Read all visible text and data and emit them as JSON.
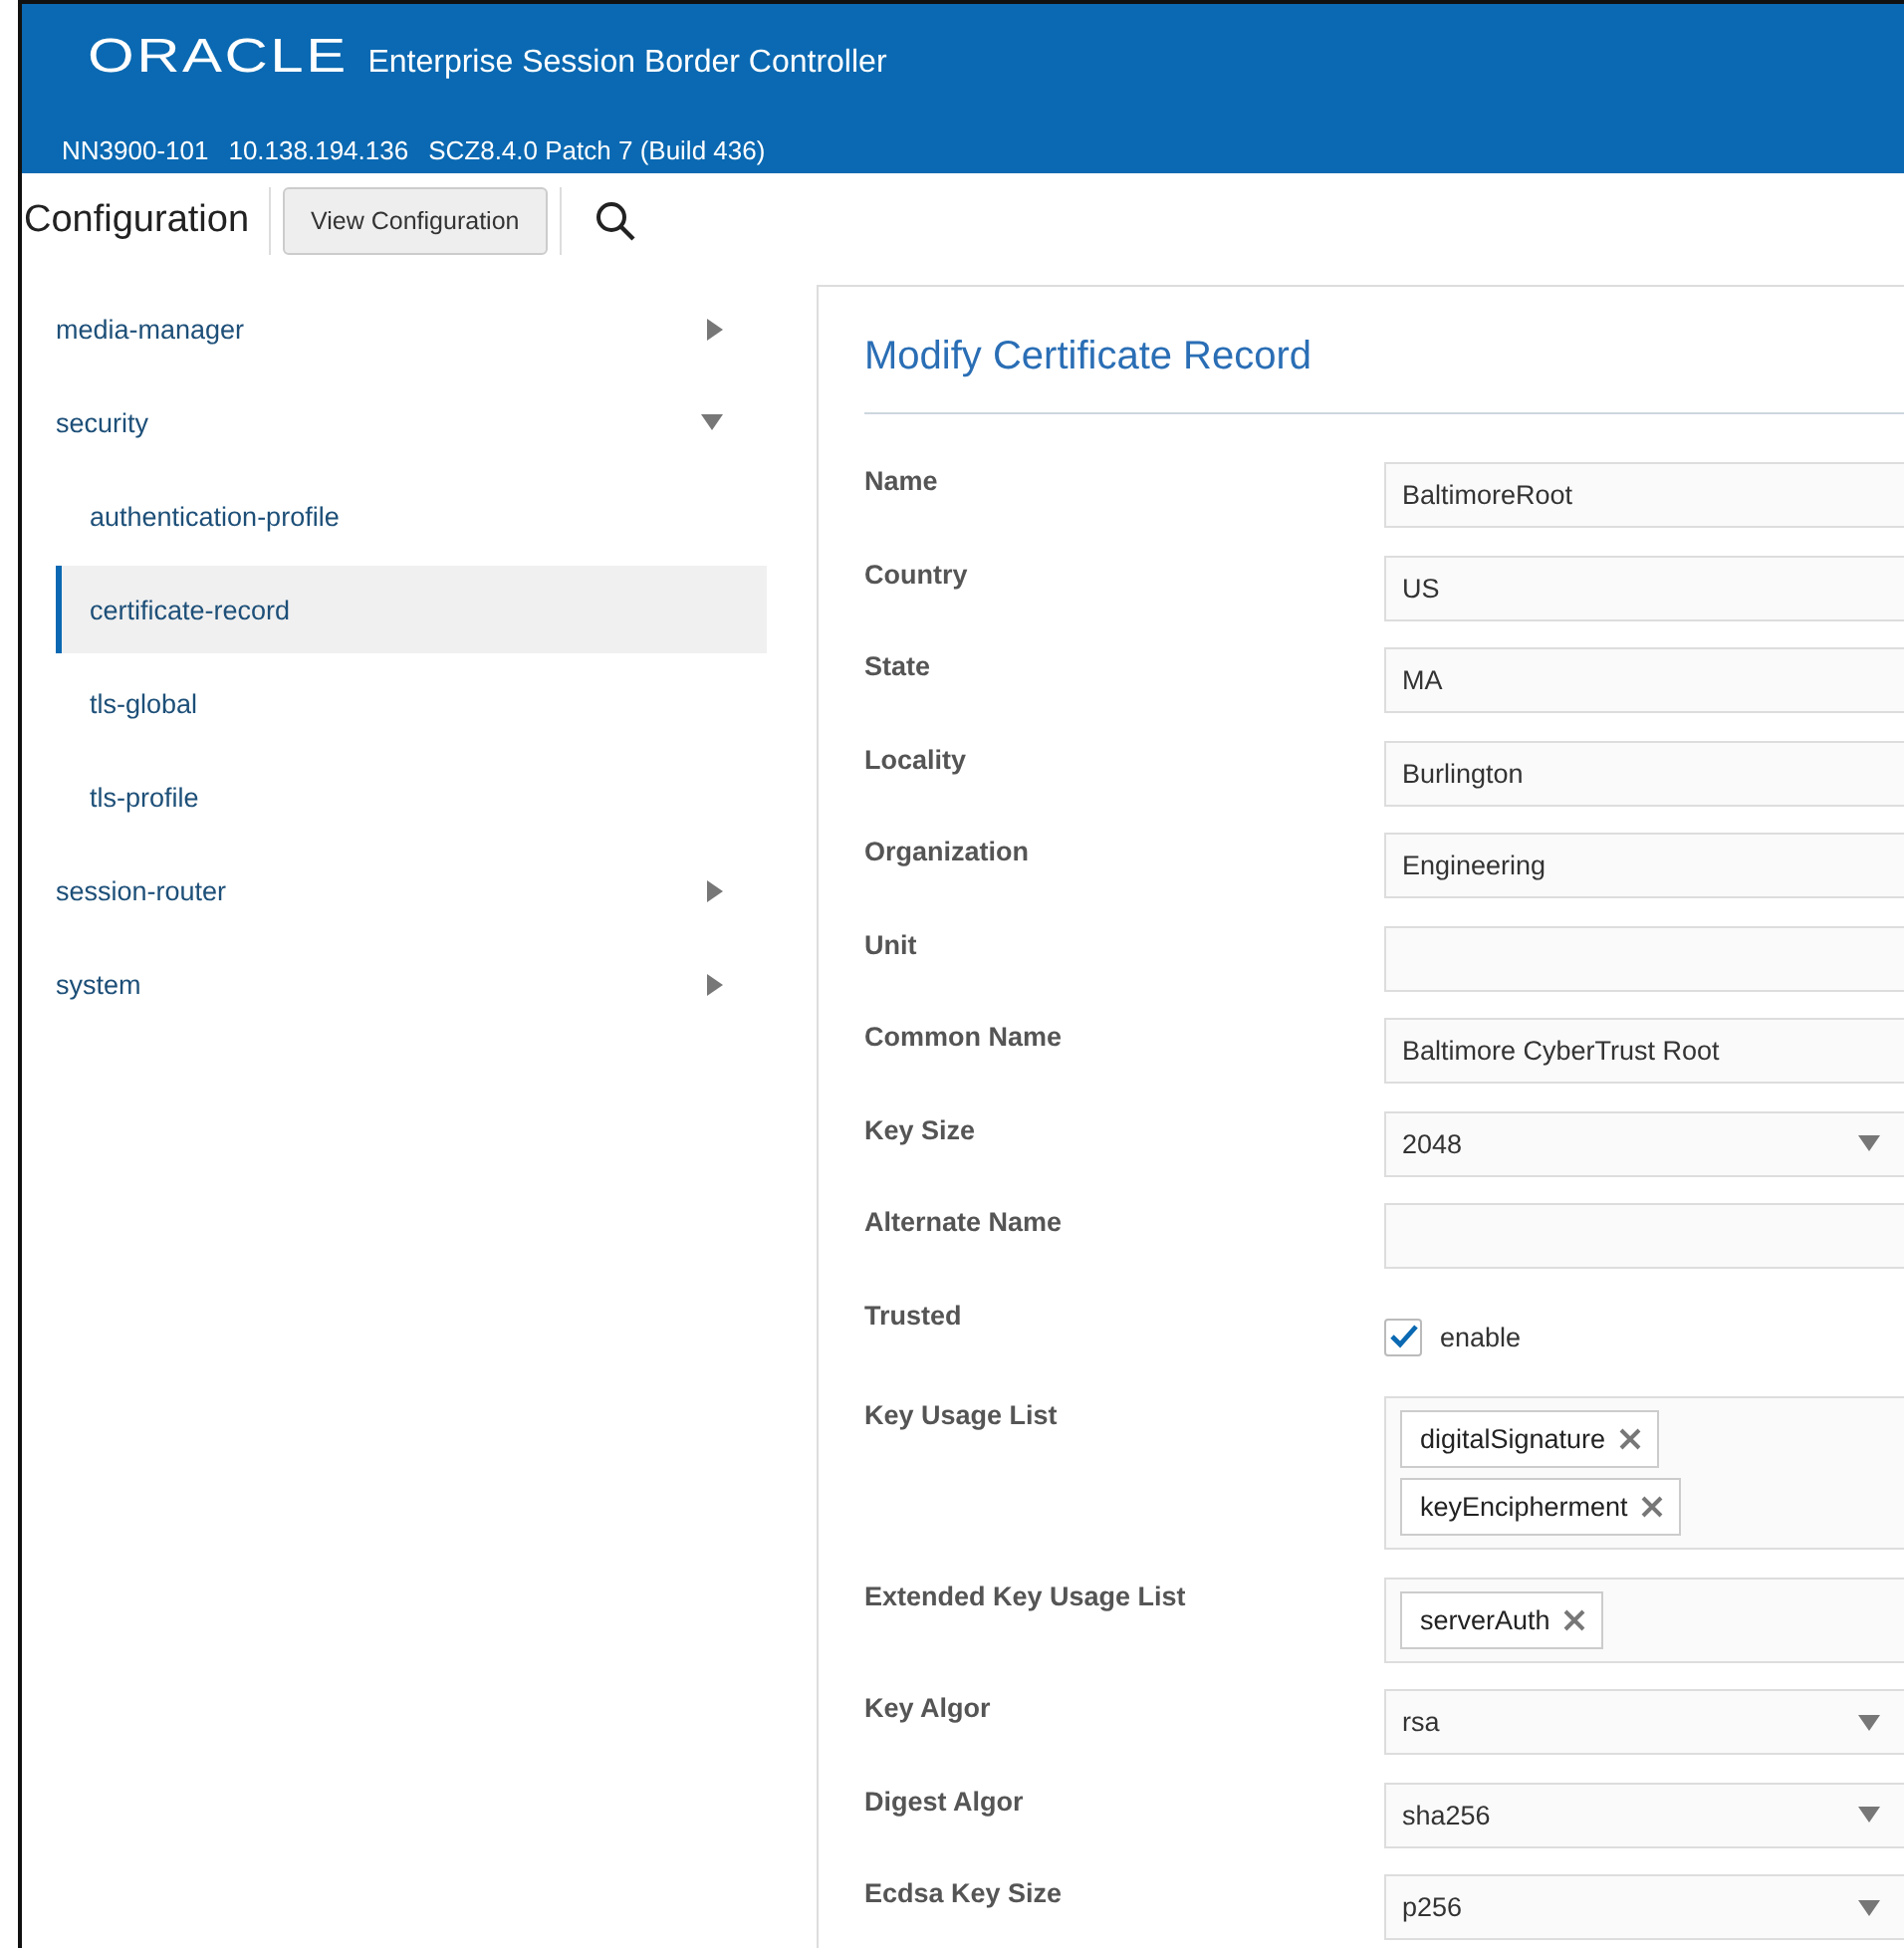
{
  "header": {
    "logo": "ORACLE",
    "product": "Enterprise Session Border Controller",
    "info": [
      "NN3900-101",
      "10.138.194.136",
      "SCZ8.4.0 Patch 7 (Build 436)"
    ]
  },
  "toolbar": {
    "title": "Configuration",
    "button": "View Configuration"
  },
  "sidebar": {
    "items": [
      {
        "label": "media-manager",
        "expanded": false,
        "selected": false
      },
      {
        "label": "security",
        "expanded": true,
        "selected": false,
        "children": [
          {
            "label": "authentication-profile",
            "selected": false
          },
          {
            "label": "certificate-record",
            "selected": true
          },
          {
            "label": "tls-global",
            "selected": false
          },
          {
            "label": "tls-profile",
            "selected": false
          }
        ]
      },
      {
        "label": "session-router",
        "expanded": false,
        "selected": false
      },
      {
        "label": "system",
        "expanded": false,
        "selected": false
      }
    ]
  },
  "form": {
    "title": "Modify Certificate Record",
    "fields": [
      {
        "label": "Name",
        "kind": "text",
        "value": "BaltimoreRoot"
      },
      {
        "label": "Country",
        "kind": "text",
        "value": "US"
      },
      {
        "label": "State",
        "kind": "text",
        "value": "MA"
      },
      {
        "label": "Locality",
        "kind": "text",
        "value": "Burlington"
      },
      {
        "label": "Organization",
        "kind": "text",
        "value": "Engineering"
      },
      {
        "label": "Unit",
        "kind": "text"
      },
      {
        "label": "Common Name",
        "kind": "text",
        "value": "Baltimore CyberTrust Root"
      },
      {
        "label": "Key Size",
        "kind": "select",
        "value": "2048"
      },
      {
        "label": "Alternate Name",
        "kind": "text"
      },
      {
        "label": "Trusted",
        "kind": "checkbox",
        "checked": true,
        "option": "enable"
      },
      {
        "label": "Key Usage List",
        "kind": "tags",
        "tags": [
          "digitalSignature",
          "keyEncipherment"
        ]
      },
      {
        "label": "Extended Key Usage List",
        "kind": "tags",
        "tags": [
          "serverAuth"
        ]
      },
      {
        "label": "Key Algor",
        "kind": "select",
        "value": "rsa"
      },
      {
        "label": "Digest Algor",
        "kind": "select",
        "value": "sha256"
      },
      {
        "label": "Ecdsa Key Size",
        "kind": "select",
        "value": "p256"
      }
    ]
  }
}
